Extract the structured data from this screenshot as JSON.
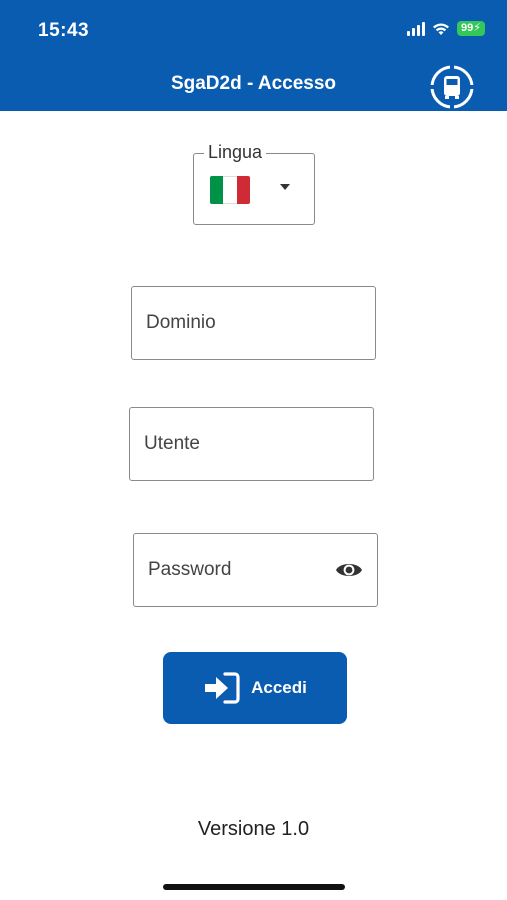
{
  "status_bar": {
    "time": "15:43",
    "battery": "99"
  },
  "header": {
    "title": "SgaD2d - Accesso",
    "action_icon": "truck-icon"
  },
  "language": {
    "legend": "Lingua",
    "selected_flag": "italy-flag"
  },
  "form": {
    "domain_placeholder": "Dominio",
    "user_placeholder": "Utente",
    "password_placeholder": "Password",
    "password_toggle_icon": "eye-icon"
  },
  "login_button": {
    "label": "Accedi",
    "icon": "login-icon"
  },
  "footer": {
    "version": "Versione 1.0"
  },
  "colors": {
    "primary": "#0a5cb0",
    "battery_green": "#34c759",
    "flag_green": "#009246",
    "flag_white": "#ffffff",
    "flag_red": "#ce2b37"
  }
}
